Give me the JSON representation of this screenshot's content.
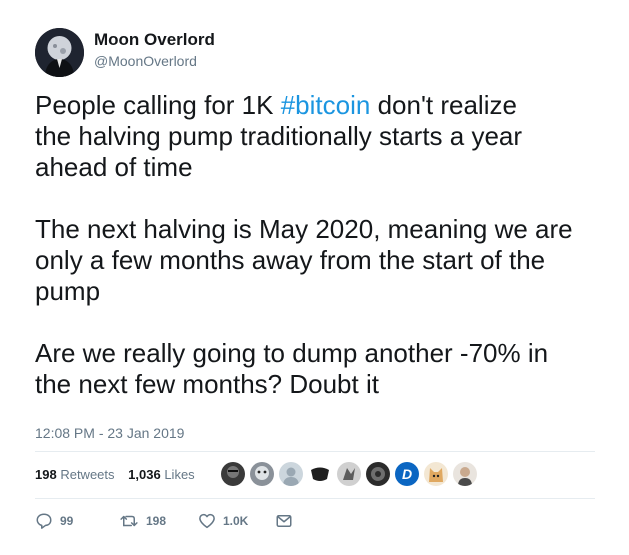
{
  "author": {
    "name": "Moon Overlord",
    "handle": "@MoonOverlord"
  },
  "tweet": {
    "paragraphs": [
      {
        "before": "People calling for 1K ",
        "hashtag": "#bitcoin",
        "after": " don't realize",
        "lines": [
          "the halving pump traditionally starts a year",
          "ahead of time"
        ]
      },
      {
        "lines": [
          "The next halving is May 2020, meaning we are",
          "only a few months away from the start of the",
          "pump"
        ]
      },
      {
        "lines": [
          "Are we really going to dump another -70% in",
          "the next few months? Doubt it"
        ]
      }
    ],
    "timestamp": "12:08 PM - 23 Jan 2019"
  },
  "stats": {
    "retweets_count": "198",
    "retweets_label": "Retweets",
    "likes_count": "1,036",
    "likes_label": "Likes"
  },
  "liker_avatars": [
    {
      "icon": "avatar-dark-face",
      "color": "#3a3a3a"
    },
    {
      "icon": "avatar-cartoon",
      "color": "#8a9199"
    },
    {
      "icon": "avatar-default-person",
      "color": "#b8c0c8"
    },
    {
      "icon": "avatar-black-mask",
      "color": "#1e1e1e"
    },
    {
      "icon": "avatar-grey-bird",
      "color": "#5c5c5c"
    },
    {
      "icon": "avatar-round-logo",
      "color": "#2b2b2b"
    },
    {
      "icon": "avatar-digibyte-logo",
      "color": "#0b66c2"
    },
    {
      "icon": "avatar-shiba-dog",
      "color": "#e0a860"
    },
    {
      "icon": "avatar-person-photo",
      "color": "#c9b7a6"
    }
  ],
  "actions": {
    "reply_count": "99",
    "retweet_count": "198",
    "like_count": "1.0K"
  },
  "colors": {
    "accent": "#1b95e0",
    "text": "#14171a",
    "secondary": "#657786",
    "divider": "#e6ecf0"
  }
}
